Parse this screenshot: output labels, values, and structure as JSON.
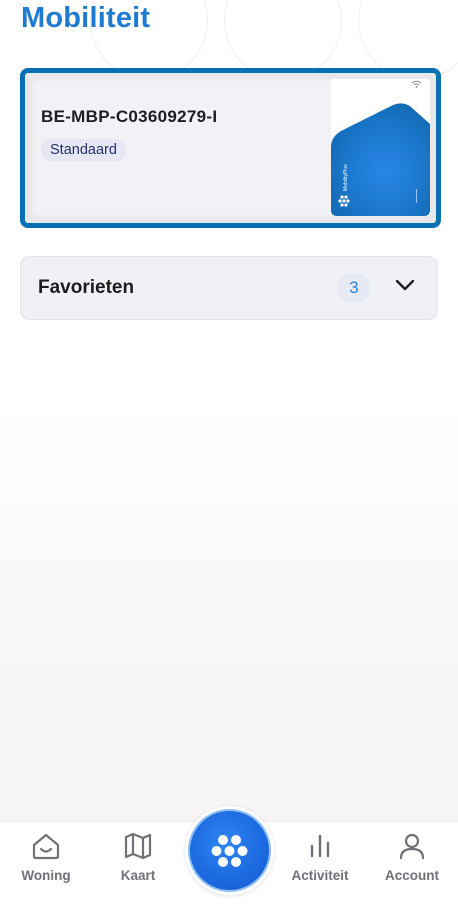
{
  "header": {
    "title": "Mobiliteit"
  },
  "card": {
    "id": "BE-MBP-C03609279-I",
    "tier": "Standaard",
    "brand_text": "MobilityPlus",
    "accent_color": "#0b6fb3"
  },
  "favorites": {
    "label": "Favorieten",
    "count": "3",
    "toggle_icon": "chevron-down-icon"
  },
  "bottom_nav": {
    "items": [
      {
        "label": "Woning",
        "icon": "home-icon"
      },
      {
        "label": "Kaart",
        "icon": "map-icon"
      },
      {
        "label": "",
        "icon": "mobilityplus-logo-icon"
      },
      {
        "label": "Activiteit",
        "icon": "bar-chart-icon"
      },
      {
        "label": "Account",
        "icon": "user-icon"
      }
    ],
    "center_button_color": "#1d6be2"
  }
}
